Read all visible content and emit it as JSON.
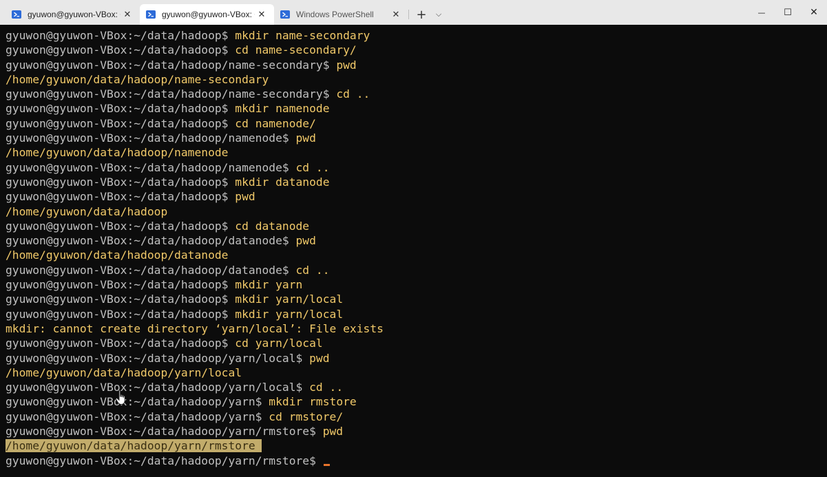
{
  "tabs": [
    {
      "label": "gyuwon@gyuwon-VBox: ~/ha",
      "icon": "powershell-icon",
      "state": "inactive"
    },
    {
      "label": "gyuwon@gyuwon-VBox: ~/c",
      "icon": "powershell-icon",
      "state": "active"
    },
    {
      "label": "Windows PowerShell",
      "icon": "powershell-icon",
      "state": "inactive"
    }
  ],
  "tabbar": {
    "new_tab": "+",
    "dropdown": "⌵",
    "minimize": "—",
    "maximize": "☐",
    "close": "✕",
    "tab_close": "✕"
  },
  "colors": {
    "background": "#0c0c0c",
    "prompt": "#c0c0c0",
    "command": "#f1c969",
    "selection": "#c2ac6b",
    "cursor": "#e8742b"
  },
  "terminal": {
    "lines": [
      {
        "prompt": "gyuwon@gyuwon-VBox:~/data/hadoop$ ",
        "text": "mkdir name-secondary"
      },
      {
        "prompt": "gyuwon@gyuwon-VBox:~/data/hadoop$ ",
        "text": "cd name-secondary/"
      },
      {
        "prompt": "gyuwon@gyuwon-VBox:~/data/hadoop/name-secondary$ ",
        "text": "pwd"
      },
      {
        "output": "/home/gyuwon/data/hadoop/name-secondary"
      },
      {
        "prompt": "gyuwon@gyuwon-VBox:~/data/hadoop/name-secondary$ ",
        "text": "cd .."
      },
      {
        "prompt": "gyuwon@gyuwon-VBox:~/data/hadoop$ ",
        "text": "mkdir namenode"
      },
      {
        "prompt": "gyuwon@gyuwon-VBox:~/data/hadoop$ ",
        "text": "cd namenode/"
      },
      {
        "prompt": "gyuwon@gyuwon-VBox:~/data/hadoop/namenode$ ",
        "text": "pwd"
      },
      {
        "output": "/home/gyuwon/data/hadoop/namenode"
      },
      {
        "prompt": "gyuwon@gyuwon-VBox:~/data/hadoop/namenode$ ",
        "text": "cd .."
      },
      {
        "prompt": "gyuwon@gyuwon-VBox:~/data/hadoop$ ",
        "text": "mkdir datanode"
      },
      {
        "prompt": "gyuwon@gyuwon-VBox:~/data/hadoop$ ",
        "text": "pwd"
      },
      {
        "output": "/home/gyuwon/data/hadoop"
      },
      {
        "prompt": "gyuwon@gyuwon-VBox:~/data/hadoop$ ",
        "text": "cd datanode"
      },
      {
        "prompt": "gyuwon@gyuwon-VBox:~/data/hadoop/datanode$ ",
        "text": "pwd"
      },
      {
        "output": "/home/gyuwon/data/hadoop/datanode"
      },
      {
        "prompt": "gyuwon@gyuwon-VBox:~/data/hadoop/datanode$ ",
        "text": "cd .."
      },
      {
        "prompt": "gyuwon@gyuwon-VBox:~/data/hadoop$ ",
        "text": "mkdir yarn"
      },
      {
        "prompt": "gyuwon@gyuwon-VBox:~/data/hadoop$ ",
        "text": "mkdir yarn/local"
      },
      {
        "prompt": "gyuwon@gyuwon-VBox:~/data/hadoop$ ",
        "text": "mkdir yarn/local"
      },
      {
        "output": "mkdir: cannot create directory ‘yarn/local’: File exists"
      },
      {
        "prompt": "gyuwon@gyuwon-VBox:~/data/hadoop$ ",
        "text": "cd yarn/local"
      },
      {
        "prompt": "gyuwon@gyuwon-VBox:~/data/hadoop/yarn/local$ ",
        "text": "pwd"
      },
      {
        "output": "/home/gyuwon/data/hadoop/yarn/local"
      },
      {
        "prompt": "gyuwon@gyuwon-VBox:~/data/hadoop/yarn/local$ ",
        "text": "cd .."
      },
      {
        "prompt": "gyuwon@gyuwon-VBox:~/data/hadoop/yarn$ ",
        "text": "mkdir rmstore"
      },
      {
        "prompt": "gyuwon@gyuwon-VBox:~/data/hadoop/yarn$ ",
        "text": "cd rmstore/"
      },
      {
        "prompt": "gyuwon@gyuwon-VBox:~/data/hadoop/yarn/rmstore$ ",
        "text": "pwd"
      },
      {
        "output": "/home/gyuwon/data/hadoop/yarn/rmstore ",
        "highlighted": true
      },
      {
        "prompt": "gyuwon@gyuwon-VBox:~/data/hadoop/yarn/rmstore$ ",
        "text": "",
        "cursor": true
      }
    ]
  }
}
